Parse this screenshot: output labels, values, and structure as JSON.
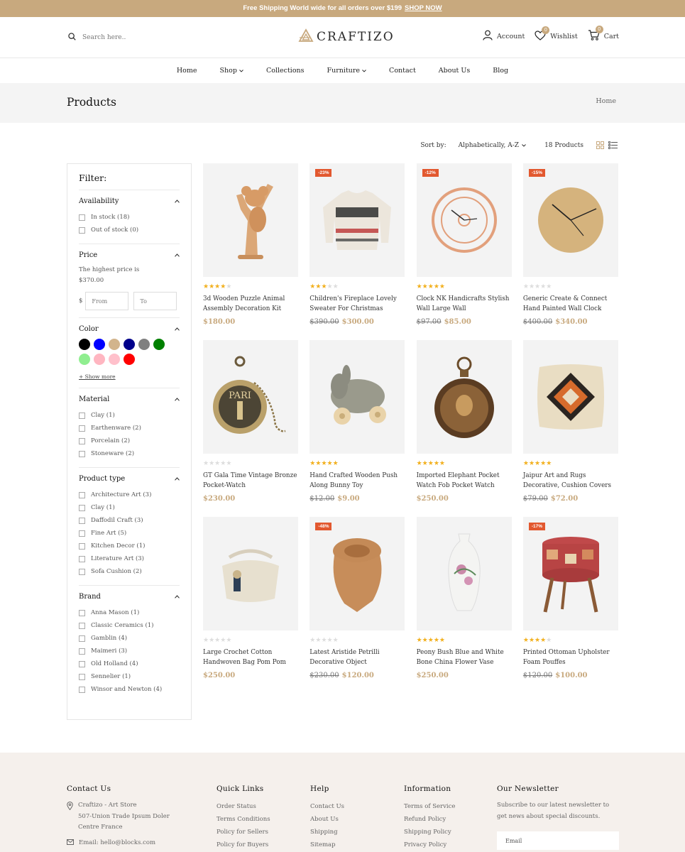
{
  "announcement": {
    "text": "Free Shipping World wide for all orders over $199",
    "link": "SHOP NOW"
  },
  "header": {
    "search_placeholder": "Search here..",
    "logo": "CRAFTIZO",
    "account": "Account",
    "wishlist": "Wishlist",
    "wishlist_count": "0",
    "cart": "Cart",
    "cart_count": "0"
  },
  "nav": [
    "Home",
    "Shop",
    "Collections",
    "Furniture",
    "Contact",
    "About Us",
    "Blog"
  ],
  "page": {
    "title": "Products",
    "breadcrumb": "Home"
  },
  "toolbar": {
    "sort_label": "Sort by:",
    "sort_value": "Alphabetically, A-Z",
    "count": "18 Products"
  },
  "filters": {
    "title": "Filter:",
    "availability": {
      "title": "Availability",
      "options": [
        "In stock (18)",
        "Out of stock (0)"
      ]
    },
    "price": {
      "title": "Price",
      "line1": "The highest price is",
      "line2": "$370.00",
      "currency": "$",
      "from": "From",
      "to": "To"
    },
    "color": {
      "title": "Color",
      "swatches": [
        "#000000",
        "#0000ff",
        "#d2b48c",
        "#00008b",
        "#808080",
        "#008000",
        "#90ee90",
        "#ffb6c1",
        "#ffc0cb",
        "#ff0000"
      ],
      "show_more": "+ Show more"
    },
    "material": {
      "title": "Material",
      "options": [
        "Clay (1)",
        "Earthenware (2)",
        "Porcelain (2)",
        "Stoneware (2)"
      ]
    },
    "product_type": {
      "title": "Product type",
      "options": [
        "Architecture Art (3)",
        "Clay (1)",
        "Daffodil Craft (3)",
        "Fine Art (5)",
        "Kitchen Decor (1)",
        "Literature Art (3)",
        "Sofa Cushion (2)"
      ]
    },
    "brand": {
      "title": "Brand",
      "options": [
        "Anna Mason (1)",
        "Classic Ceramics (1)",
        "Gamblin (4)",
        "Maimeri (3)",
        "Old Holland (4)",
        "Sennelier (1)",
        "Winsor and Newton (4)"
      ]
    }
  },
  "products": [
    {
      "name": "3d Wooden Puzzle Animal Assembly Decoration Kit",
      "rating": 4,
      "old": "",
      "price": "$180.00",
      "badge": "",
      "icon": "koala-puzzle"
    },
    {
      "name": "Children's Fireplace Lovely Sweater For Christmas",
      "rating": 3,
      "old": "$390.00",
      "price": "$300.00",
      "badge": "-23%",
      "icon": "sweater"
    },
    {
      "name": "Clock NK Handicrafts Stylish Wall Large Wall",
      "rating": 5,
      "old": "$97.00",
      "price": "$85.00",
      "badge": "-12%",
      "icon": "roman-clock"
    },
    {
      "name": "Generic Create & Connect Hand Painted Wall Clock",
      "rating": 0,
      "old": "$400.00",
      "price": "$340.00",
      "badge": "-15%",
      "icon": "gold-clock"
    },
    {
      "name": "GT Gala Time Vintage Bronze Pocket-Watch",
      "rating": 0,
      "old": "",
      "price": "$230.00",
      "badge": "",
      "icon": "paris-watch"
    },
    {
      "name": "Hand Crafted Wooden Push Along Bunny Toy",
      "rating": 5,
      "old": "$12.00",
      "price": "$9.00",
      "badge": "",
      "icon": "bunny-toy"
    },
    {
      "name": "Imported Elephant Pocket Watch Fob Pocket Watch",
      "rating": 5,
      "old": "",
      "price": "$250.00",
      "badge": "",
      "icon": "pocket-watch"
    },
    {
      "name": "Jaipur Art and Rugs Decorative, Cushion Covers",
      "rating": 5,
      "old": "$79.00",
      "price": "$72.00",
      "badge": "",
      "icon": "cushion"
    },
    {
      "name": "Large Crochet Cotton Handwoven Bag Pom Pom",
      "rating": 0,
      "old": "",
      "price": "$250.00",
      "badge": "",
      "icon": "crochet-bag"
    },
    {
      "name": "Latest Aristide Petrilli Decorative Object",
      "rating": 0,
      "old": "$230.00",
      "price": "$120.00",
      "badge": "-48%",
      "icon": "scarf"
    },
    {
      "name": "Peony Bush Blue and White Bone China Flower Vase",
      "rating": 5,
      "old": "",
      "price": "$250.00",
      "badge": "",
      "icon": "vase"
    },
    {
      "name": "Printed Ottoman Upholster Foam Pouffes",
      "rating": 4,
      "old": "$120.00",
      "price": "$100.00",
      "badge": "-17%",
      "icon": "ottoman"
    }
  ],
  "footer": {
    "contact": {
      "title": "Contact Us",
      "lines": [
        "Craftizo - Art Store",
        "507-Union Trade Ipsum Doler",
        "Centre France"
      ],
      "email": "Email: hello@blocks.com"
    },
    "quick": {
      "title": "Quick Links",
      "links": [
        "Order Status",
        "Terms Conditions",
        "Policy for Sellers",
        "Policy for Buyers"
      ]
    },
    "help": {
      "title": "Help",
      "links": [
        "Contact Us",
        "About Us",
        "Shipping",
        "Sitemap"
      ]
    },
    "info": {
      "title": "Information",
      "links": [
        "Terms of Service",
        "Refund Policy",
        "Shipping Policy",
        "Privacy Policy"
      ]
    },
    "newsletter": {
      "title": "Our Newsletter",
      "text": "Subscribe to our latest newsletter to get news about special discounts.",
      "placeholder": "Email"
    }
  }
}
